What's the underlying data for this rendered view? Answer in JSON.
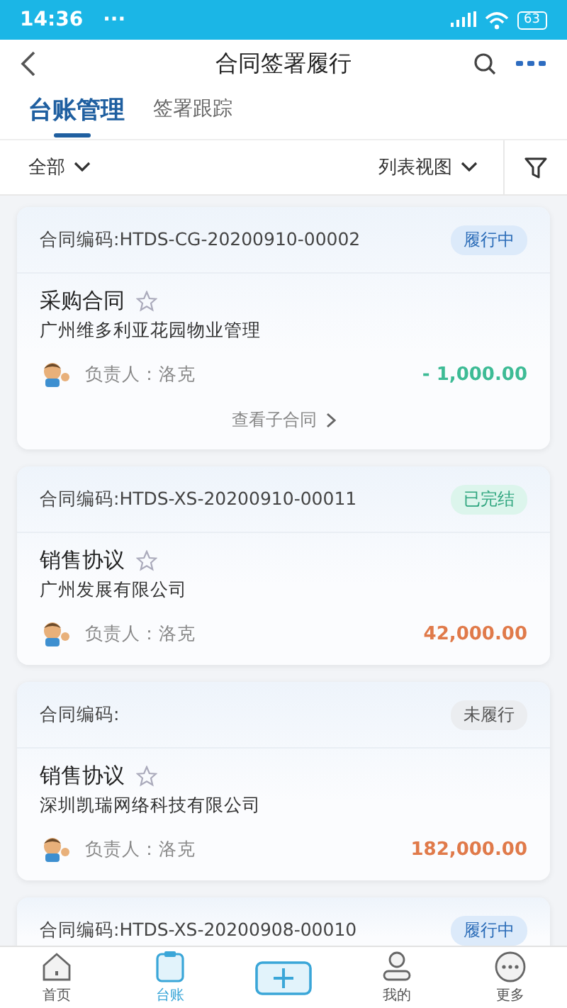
{
  "status_bar": {
    "time": "14:36",
    "dots": "···",
    "battery": "63"
  },
  "header": {
    "title": "合同签署履行"
  },
  "tabs": [
    {
      "label": "台账管理",
      "selected": true
    },
    {
      "label": "签署跟踪",
      "selected": false
    }
  ],
  "filter_bar": {
    "scope": "全部",
    "view": "列表视图"
  },
  "contracts": [
    {
      "code": "合同编码:HTDS-CG-20200910-00002",
      "status": "履行中",
      "kind": "active",
      "title": "采购合同",
      "starred": false,
      "company": "广州维多利亚花园物业管理",
      "owner": "负责人：洛克",
      "amount": "- 1,000.00",
      "color": "#3dbb95",
      "sub_link": "查看子合同"
    },
    {
      "code": "合同编码:HTDS-XS-20200910-00011",
      "status": "已完结",
      "kind": "done",
      "title": "销售协议",
      "starred": false,
      "company": "广州发展有限公司",
      "owner": "负责人：洛克",
      "amount": "42,000.00",
      "color": "#e07a4a"
    },
    {
      "code": "合同编码:",
      "status": "未履行",
      "kind": "pending",
      "title": "销售协议",
      "starred": false,
      "company": "深圳凯瑞网络科技有限公司",
      "owner": "负责人：洛克",
      "amount": "182,000.00",
      "color": "#e07a4a"
    },
    {
      "code": "合同编码:HTDS-XS-20200908-00010",
      "status": "履行中",
      "kind": "active"
    }
  ],
  "bottom_nav": [
    {
      "label": "首页",
      "kind": "home",
      "selected": false
    },
    {
      "label": "台账",
      "kind": "ledger",
      "selected": true
    },
    {
      "kind": "add",
      "selected": false
    },
    {
      "label": "我的",
      "kind": "person",
      "selected": false
    },
    {
      "label": "更多",
      "kind": "more",
      "selected": false
    }
  ]
}
